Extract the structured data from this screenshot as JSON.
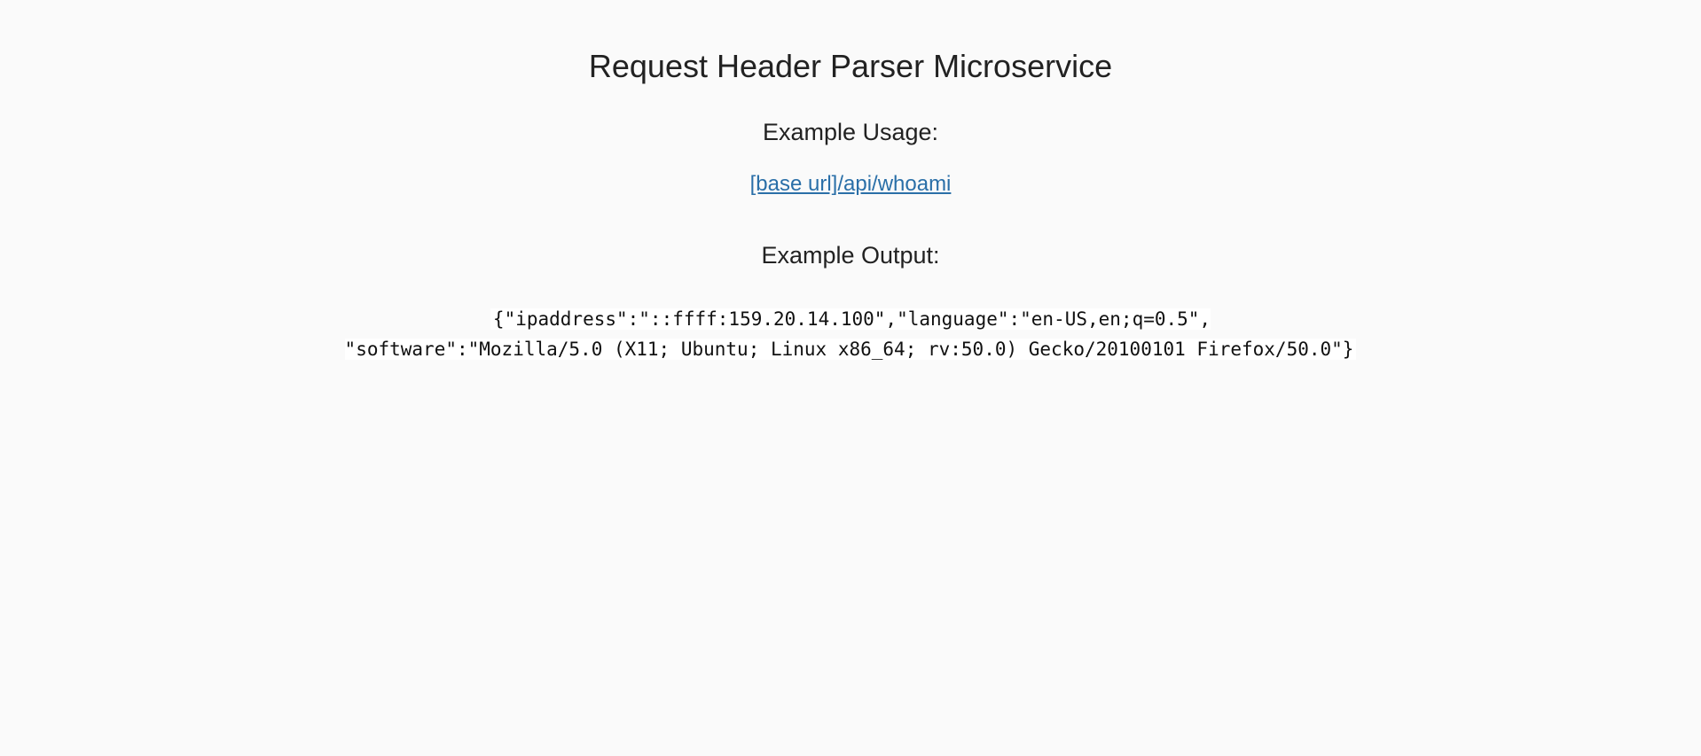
{
  "page": {
    "title": "Request Header Parser Microservice",
    "usage_heading": "Example Usage:",
    "usage_link": "[base url]/api/whoami",
    "output_heading": "Example Output:",
    "output_line1": "{\"ipaddress\":\"::ffff:159.20.14.100\",\"language\":\"en-US,en;q=0.5\",",
    "output_line2": "\"software\":\"Mozilla/5.0 (X11; Ubuntu; Linux x86_64; rv:50.0) Gecko/20100101 Firefox/50.0\"}"
  },
  "colors": {
    "background": "#fafafa",
    "text": "#222222",
    "link": "#2a6fa8",
    "code_background": "#ffffff"
  }
}
